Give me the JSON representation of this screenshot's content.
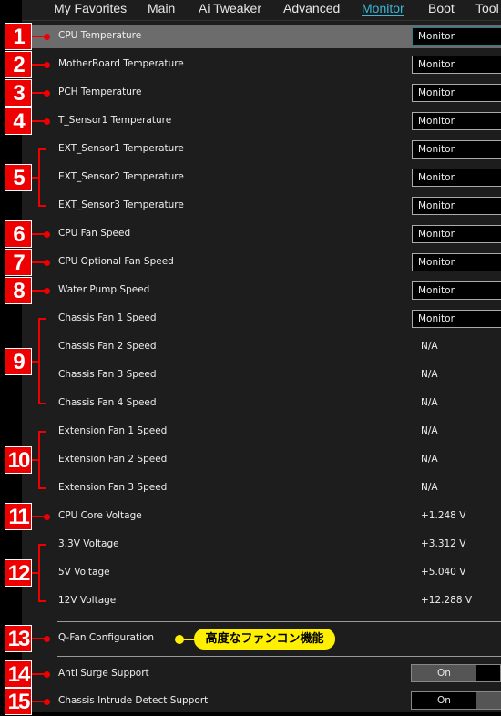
{
  "nav": {
    "tabs": [
      "My Favorites",
      "Main",
      "Ai Tweaker",
      "Advanced",
      "Monitor",
      "Boot",
      "Tool"
    ],
    "active": "Monitor"
  },
  "rows": [
    {
      "label": "CPU Temperature",
      "type": "dropdown",
      "value": "Monitor",
      "selected": true
    },
    {
      "label": "MotherBoard Temperature",
      "type": "dropdown",
      "value": "Monitor"
    },
    {
      "label": "PCH Temperature",
      "type": "dropdown",
      "value": "Monitor"
    },
    {
      "label": "T_Sensor1 Temperature",
      "type": "dropdown",
      "value": "Monitor"
    },
    {
      "label": "EXT_Sensor1  Temperature",
      "type": "dropdown",
      "value": "Monitor"
    },
    {
      "label": "EXT_Sensor2  Temperature",
      "type": "dropdown",
      "value": "Monitor"
    },
    {
      "label": "EXT_Sensor3  Temperature",
      "type": "dropdown",
      "value": "Monitor"
    },
    {
      "label": "CPU Fan Speed",
      "type": "dropdown",
      "value": "Monitor"
    },
    {
      "label": "CPU Optional Fan Speed",
      "type": "dropdown",
      "value": "Monitor"
    },
    {
      "label": "Water Pump Speed",
      "type": "dropdown",
      "value": "Monitor"
    },
    {
      "label": "Chassis Fan 1 Speed",
      "type": "dropdown",
      "value": "Monitor"
    },
    {
      "label": "Chassis Fan 2 Speed",
      "type": "value",
      "value": "N/A"
    },
    {
      "label": "Chassis Fan 3 Speed",
      "type": "value",
      "value": "N/A"
    },
    {
      "label": "Chassis Fan 4 Speed",
      "type": "value",
      "value": "N/A"
    },
    {
      "label": "Extension Fan 1 Speed",
      "type": "value",
      "value": "N/A"
    },
    {
      "label": "Extension Fan 2 Speed",
      "type": "value",
      "value": "N/A"
    },
    {
      "label": "Extension Fan 3 Speed",
      "type": "value",
      "value": "N/A"
    },
    {
      "label": "CPU Core Voltage",
      "type": "value",
      "value": "+1.248 V"
    },
    {
      "label": "3.3V Voltage",
      "type": "value",
      "value": "+3.312 V"
    },
    {
      "label": "5V Voltage",
      "type": "value",
      "value": "+5.040 V"
    },
    {
      "label": "12V Voltage",
      "type": "value",
      "value": "+12.288 V"
    }
  ],
  "qfan": {
    "label": "Q-Fan Configuration",
    "callout": "高度なファンコン機能"
  },
  "toggles": [
    {
      "label": "Anti Surge Support",
      "value": "On"
    },
    {
      "label": "Chassis Intrude Detect Support",
      "value": "On"
    }
  ],
  "badges": [
    "1",
    "2",
    "3",
    "4",
    "5",
    "6",
    "7",
    "8",
    "9",
    "10",
    "11",
    "12",
    "13",
    "14",
    "15"
  ],
  "colors": {
    "accent": "#3ab6d6",
    "annotation": "#ee0000",
    "callout": "#ffef00"
  }
}
